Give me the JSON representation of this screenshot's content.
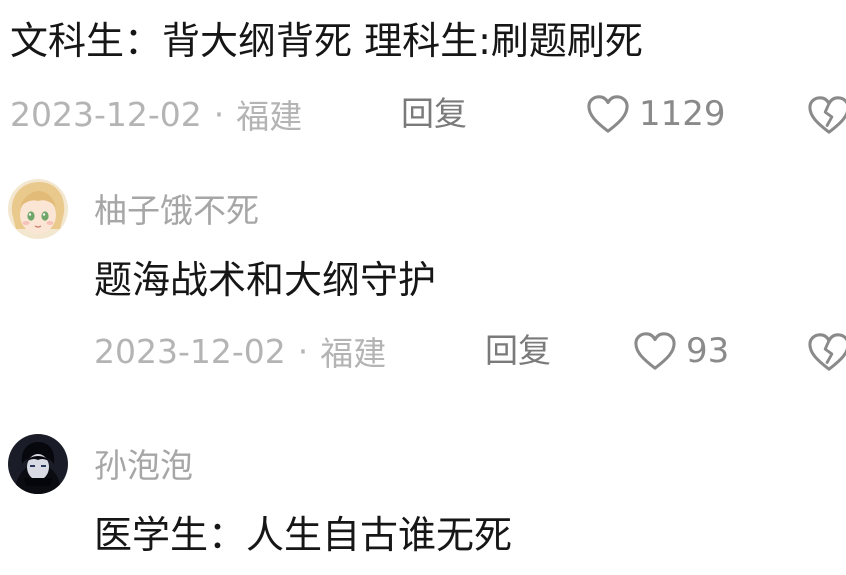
{
  "comments": [
    {
      "text": "文科生：背大纲背死  理科生:刷题刷死",
      "date": "2023-12-02",
      "separator": "·",
      "location": "福建",
      "reply_label": "回复",
      "likes": "1129",
      "like_icon": "heart-outline-icon",
      "dislike_icon": "broken-heart-icon"
    },
    {
      "username": "柚子饿不死",
      "avatar": "anime-girl-avatar",
      "text": "题海战术和大纲守护",
      "date": "2023-12-02",
      "separator": "·",
      "location": "福建",
      "reply_label": "回复",
      "likes": "93",
      "like_icon": "heart-outline-icon",
      "dislike_icon": "broken-heart-icon"
    },
    {
      "username": "孙泡泡",
      "avatar": "dark-hooded-avatar",
      "text": "医学生：人生自古谁无死"
    }
  ],
  "colors": {
    "text": "#161616",
    "meta": "#b4b4b4",
    "reply": "#7a7a7a",
    "icon": "#8a8a8a"
  }
}
